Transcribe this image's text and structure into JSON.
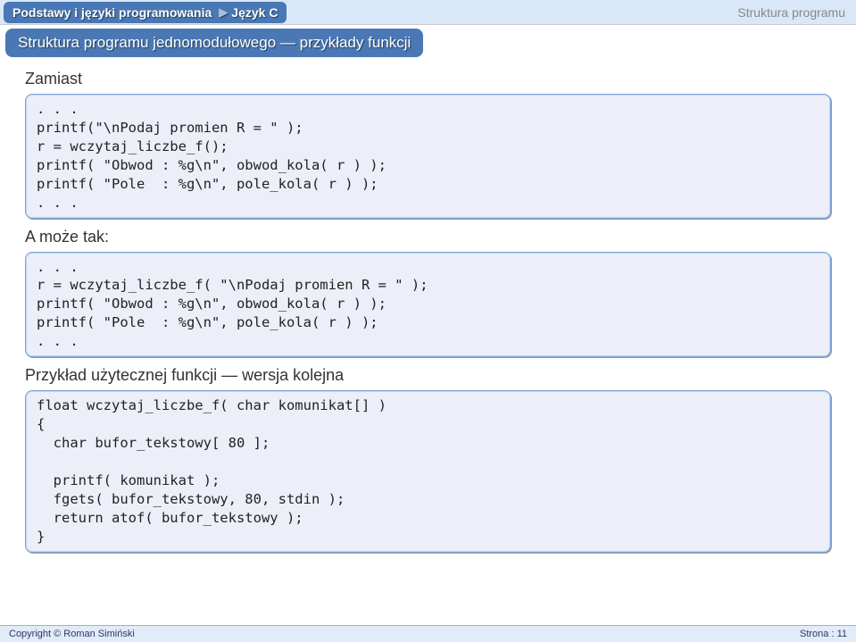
{
  "header": {
    "tab1": "Podstawy i języki programowania",
    "tab2": "Język C",
    "right": "Struktura programu"
  },
  "subtitle": "Struktura programu jednomodułowego — przykłady funkcji",
  "section1_label": "Zamiast",
  "code1": ". . .\nprintf(\"\\nPodaj promien R = \" );\nr = wczytaj_liczbe_f();\nprintf( \"Obwod : %g\\n\", obwod_kola( r ) );\nprintf( \"Pole  : %g\\n\", pole_kola( r ) );\n. . .",
  "section2_label": "A może tak:",
  "code2": ". . .\nr = wczytaj_liczbe_f( \"\\nPodaj promien R = \" );\nprintf( \"Obwod : %g\\n\", obwod_kola( r ) );\nprintf( \"Pole  : %g\\n\", pole_kola( r ) );\n. . .",
  "section3_label": "Przykład użytecznej funkcji — wersja kolejna",
  "code3": "float wczytaj_liczbe_f( char komunikat[] )\n{\n  char bufor_tekstowy[ 80 ];\n\n  printf( komunikat );\n  fgets( bufor_tekstowy, 80, stdin );\n  return atof( bufor_tekstowy );\n}",
  "footer": {
    "left": "Copyright © Roman Simiński",
    "right": "Strona : 11"
  }
}
